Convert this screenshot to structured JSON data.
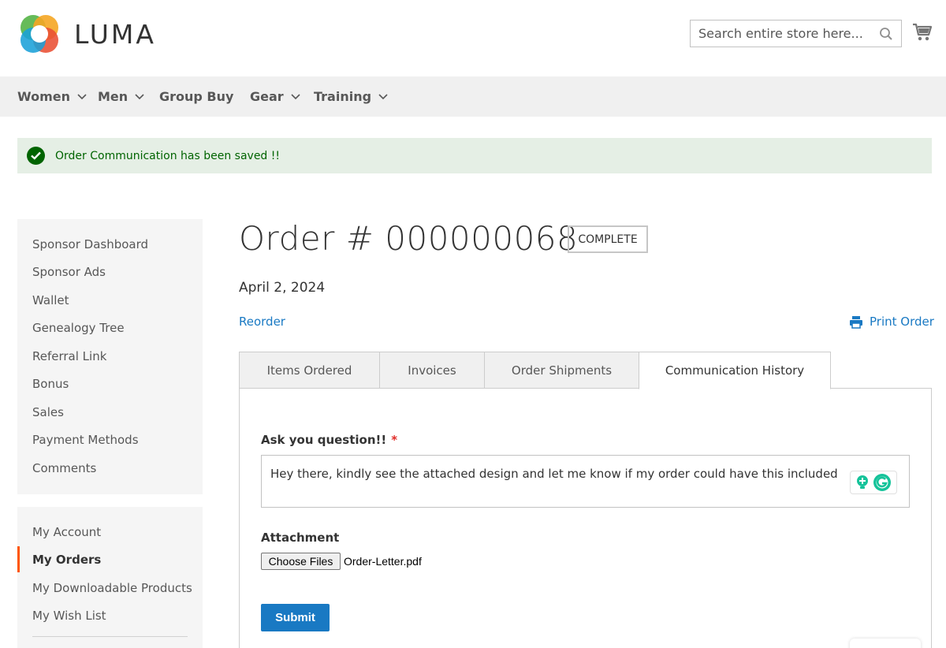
{
  "header": {
    "logo_text": "LUMA",
    "search_placeholder": "Search entire store here...",
    "search_icon": "search-icon",
    "cart_icon": "cart-icon"
  },
  "nav": {
    "items": [
      {
        "label": "Women",
        "has_dropdown": true
      },
      {
        "label": "Men",
        "has_dropdown": true
      },
      {
        "label": "Group Buy",
        "has_dropdown": false
      },
      {
        "label": "Gear",
        "has_dropdown": true
      },
      {
        "label": "Training",
        "has_dropdown": true
      }
    ]
  },
  "message": {
    "text": "Order Communication has been saved !!",
    "type": "success",
    "color": "#006400"
  },
  "sidebar": {
    "group1": [
      "Sponsor Dashboard",
      "Sponsor Ads",
      "Wallet",
      "Genealogy Tree",
      "Referral Link",
      "Bonus",
      "Sales",
      "Payment Methods",
      "Comments"
    ],
    "group2": [
      "My Account",
      "My Orders",
      "My Downloadable Products",
      "My Wish List"
    ],
    "current": "My Orders",
    "accent_color": "#ff5501"
  },
  "order": {
    "title": "Order # 000000068",
    "status": "COMPLETE",
    "date": "April 2, 2024",
    "reorder_label": "Reorder",
    "print_label": "Print Order"
  },
  "tabs": [
    {
      "label": "Items Ordered",
      "active": false
    },
    {
      "label": "Invoices",
      "active": false
    },
    {
      "label": "Order Shipments",
      "active": false
    },
    {
      "label": "Communication History",
      "active": true
    }
  ],
  "form": {
    "question_label": "Ask you question!!",
    "required_mark": "*",
    "question_value": "Hey there, kindly see the attached design and let me know if my order could have this included",
    "attachment_label": "Attachment",
    "choose_files_label": "Choose Files",
    "file_name": "Order-Letter.pdf",
    "submit_label": "Submit"
  },
  "colors": {
    "link": "#1979c3",
    "primary_button": "#1979c3",
    "success_bg": "#e5efe5"
  }
}
